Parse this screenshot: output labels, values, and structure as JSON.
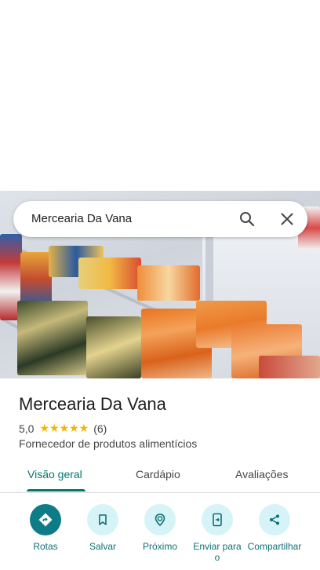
{
  "search": {
    "query": "Mercearia Da Vana"
  },
  "place": {
    "title": "Mercearia Da Vana",
    "rating": "5,0",
    "stars": "★★★★★",
    "review_count": "(6)",
    "category": "Fornecedor de produtos alimentícios"
  },
  "tabs": [
    {
      "label": "Visão geral"
    },
    {
      "label": "Cardápio"
    },
    {
      "label": "Avaliações"
    }
  ],
  "actions": [
    {
      "label": "Rotas",
      "icon": "directions-icon"
    },
    {
      "label": "Salvar",
      "icon": "bookmark-icon"
    },
    {
      "label": "Próximo",
      "icon": "nearby-icon"
    },
    {
      "label": "Enviar para o",
      "icon": "send-to-phone-icon"
    },
    {
      "label": "Compartilhar",
      "icon": "share-icon"
    }
  ],
  "colors": {
    "accent": "#00796b",
    "action_bg": "#d6f3f7",
    "primary_action": "#0e7c86",
    "star": "#f4b400"
  }
}
